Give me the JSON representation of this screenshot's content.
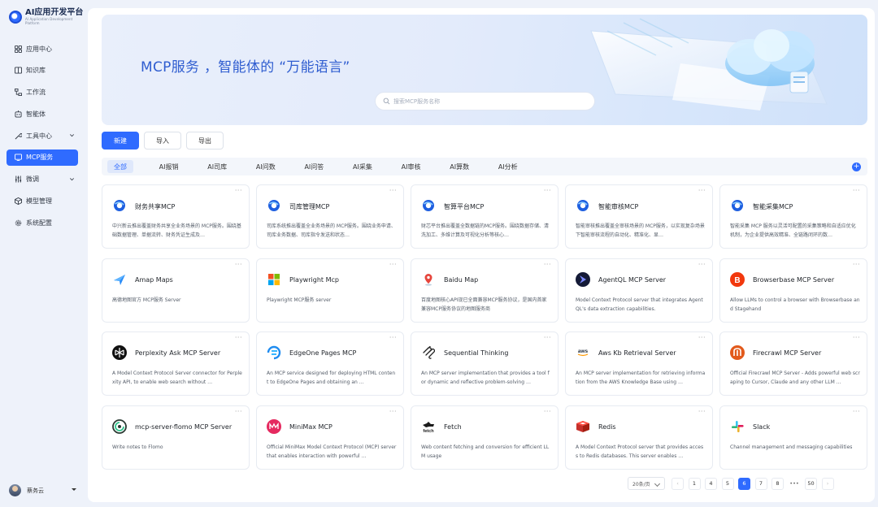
{
  "app": {
    "title": "AI应用开发平台",
    "subtitle": "AI Application Development Platform"
  },
  "sidebar": {
    "items": [
      {
        "label": "应用中心",
        "icon": "grid-icon"
      },
      {
        "label": "知识库",
        "icon": "book-icon"
      },
      {
        "label": "工作流",
        "icon": "workflow-icon"
      },
      {
        "label": "智能体",
        "icon": "agent-icon"
      },
      {
        "label": "工具中心",
        "icon": "tool-icon"
      },
      {
        "label": "MCP服务",
        "icon": "mcp-icon"
      },
      {
        "label": "微调",
        "icon": "tune-icon"
      },
      {
        "label": "模型管理",
        "icon": "cube-icon"
      },
      {
        "label": "系统配置",
        "icon": "gear-icon"
      }
    ],
    "active_index": 5,
    "user": {
      "name": "蔡务云"
    }
  },
  "banner": {
    "title": "MCP服务 ，智能体的 “万能语言”",
    "search_placeholder": "搜索MCP服务名称"
  },
  "toolbar": {
    "new_label": "新建",
    "import_label": "导入",
    "export_label": "导出"
  },
  "tabs": [
    "全部",
    "AI报销",
    "AI司库",
    "AI问数",
    "AI问答",
    "AI采集",
    "AI审核",
    "AI算数",
    "AI分析"
  ],
  "active_tab": 0,
  "cards": [
    {
      "name": "财务共享MCP",
      "desc": "中兴新云推出覆盖财务共享全业务场景的 MCP服务。围绕基础数据管理、单据流转、财务凭证生成及…",
      "icon": "blue-logo"
    },
    {
      "name": "司库管理MCP",
      "desc": "司库系统推出覆盖全业务场景的 MCP服务。围绕业务申请、司库业务数据、司库指令发送和状态…",
      "icon": "blue-logo"
    },
    {
      "name": "智算平台MCP",
      "desc": "财芯平台推出覆盖全数据链的MCP服务。围绕数据存储、清洗加工、多维计算及可视化分析等核心…",
      "icon": "blue-logo"
    },
    {
      "name": "智能审核MCP",
      "desc": "智能审核推出覆盖全审核场景的 MCP服务，以实现复杂场景下智能审核流程的自动化、精准化、显…",
      "icon": "blue-logo"
    },
    {
      "name": "智能采集MCP",
      "desc": "智能采集 MCP 服务以灵活可配置的采集策略和自适应优化机制，为企业提供高效精准、全链路闭环的数…",
      "icon": "blue-logo"
    },
    {
      "name": "Amap Maps",
      "desc": "高德地图官方 MCP服务 Server",
      "icon": "amap-icon"
    },
    {
      "name": "Playwright Mcp",
      "desc": "Playwright MCP服务 server",
      "icon": "windows-icon"
    },
    {
      "name": "Baidu Map",
      "desc": "百度地图核心API现已全面兼容MCP服务协议，是国内首家兼容MCP服务协议的地图服务商",
      "icon": "map-pin-icon"
    },
    {
      "name": "AgentQL MCP Server",
      "desc": "Model Context Protocol server that integrates AgentQL's data extraction capabilities.",
      "icon": "agentql-icon"
    },
    {
      "name": "Browserbase MCP Server",
      "desc": "Allow LLMs to control a browser with Browserbase and Stagehand",
      "icon": "browserbase-icon"
    },
    {
      "name": "Perplexity Ask MCP Server",
      "desc": "A Model Context Protocol Server connector for Perplexity API, to enable web search without …",
      "icon": "perplexity-icon"
    },
    {
      "name": "EdgeOne Pages MCP",
      "desc": "An MCP service designed for deploying HTML content to EdgeOne Pages and obtaining an …",
      "icon": "edgeone-icon"
    },
    {
      "name": "Sequential Thinking",
      "desc": "An MCP server implementation that provides a tool for dynamic and reflective problem-solving …",
      "icon": "mcp-logo-icon"
    },
    {
      "name": "Aws Kb Retrieval Server",
      "desc": "An MCP server implementation for retrieving information from the AWS Knowledge Base using …",
      "icon": "aws-icon"
    },
    {
      "name": "Firecrawl MCP Server",
      "desc": "Official Firecrawl MCP Server - Adds powerful web scraping to Cursor, Claude and any other LLM …",
      "icon": "firecrawl-icon"
    },
    {
      "name": "mcp-server-flomo MCP Server",
      "desc": "Write notes to Flomo",
      "icon": "flomo-icon"
    },
    {
      "name": "MiniMax MCP",
      "desc": "Official MiniMax Model Context Protocol (MCP) server that enables interaction with powerful …",
      "icon": "minimax-icon"
    },
    {
      "name": "Fetch",
      "desc": "Web content fetching and conversion for efficient LLM usage",
      "icon": "fetch-icon"
    },
    {
      "name": "Redis",
      "desc": "A Model Context Protocol server that provides access to Redis databases. This server enables …",
      "icon": "redis-icon"
    },
    {
      "name": "Slack",
      "desc": "Channel management and messaging capabilities",
      "icon": "slack-icon"
    }
  ],
  "pagination": {
    "page_size_label": "20条/页",
    "prev": "‹",
    "next": "›",
    "pages": [
      "1",
      "4",
      "5",
      "6",
      "7",
      "8",
      "•••",
      "50"
    ],
    "current": "6"
  },
  "colors": {
    "primary": "#2f6bff",
    "title_blue": "#2f5dd0"
  }
}
